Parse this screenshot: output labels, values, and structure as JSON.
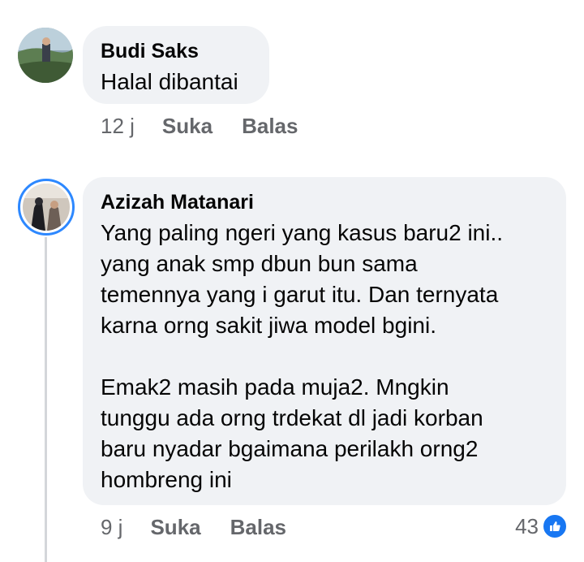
{
  "comments": [
    {
      "author": "Budi Saks",
      "text": "Halal dibantai",
      "time": "12 j",
      "like_label": "Suka",
      "reply_label": "Balas"
    },
    {
      "author": "Azizah Matanari",
      "text": "Yang paling ngeri yang kasus baru2 ini..\nyang anak smp dbun bun sama\ntemennya yang i garut itu. Dan ternyata\nkarna orng sakit jiwa model bgini.\n\nEmak2 masih pada muja2. Mngkin\ntunggu ada orng trdekat dl jadi korban\nbaru nyadar bgaimana perilakh orng2\nhombreng ini",
      "time": "9 j",
      "like_label": "Suka",
      "reply_label": "Balas",
      "reaction_count": "43",
      "reaction_icon": "like-icon"
    }
  ],
  "colors": {
    "bubble": "#f0f2f5",
    "meta_text": "#65676b",
    "story_ring": "#2d88ff",
    "like_blue": "#1877f2"
  }
}
